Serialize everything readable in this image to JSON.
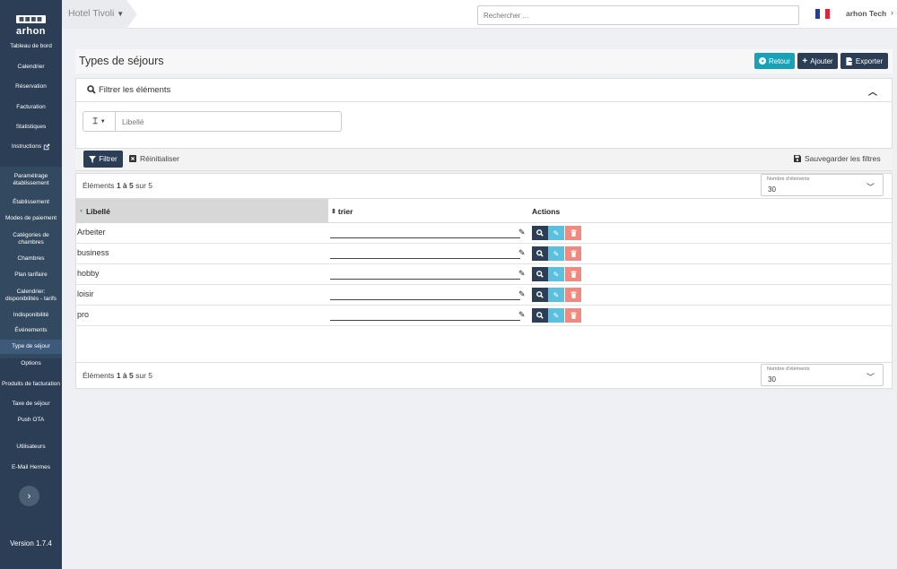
{
  "sidebar": {
    "logo_top": "arhon",
    "logo_name": "arhon",
    "items": [
      {
        "label": "Tableau de bord"
      },
      {
        "label": "Calendrier"
      },
      {
        "label": "Réservation"
      },
      {
        "label": "Facturation"
      },
      {
        "label": "Statistiques"
      },
      {
        "label": "Instructions"
      }
    ],
    "group_title": "Paramétrage établissement",
    "group_items": [
      {
        "label": "Établissement"
      },
      {
        "label": "Modes de paiement"
      },
      {
        "label": "Catégories de chambres"
      },
      {
        "label": "Chambres"
      },
      {
        "label": "Plan tarifaire"
      },
      {
        "label": "Calendrier: disponibilités - tarifs"
      },
      {
        "label": "Indisponibilité"
      },
      {
        "label": "Événements"
      },
      {
        "label": "Type de séjour"
      },
      {
        "label": "Options"
      },
      {
        "label": "Produits de facturation"
      },
      {
        "label": "Taxe de séjour"
      },
      {
        "label": "Push OTA"
      }
    ],
    "bottom_items": [
      {
        "label": "Utilisateurs"
      },
      {
        "label": "E-Mail Hermes"
      }
    ],
    "version": "Version 1.7.4"
  },
  "topbar": {
    "hotel": "Hotel Tivoli",
    "search_placeholder": "Rechercher ...",
    "user": "arhon Tech"
  },
  "page": {
    "title": "Types de séjours",
    "btn_back": "Retour",
    "btn_add": "Ajouter",
    "btn_export": "Exporter"
  },
  "filters": {
    "title": "Filtrer les éléments",
    "libelle_placeholder": "Libellé",
    "btn_filter": "Filtrer",
    "btn_reset": "Réinitialiser",
    "btn_save": "Sauvegarder les filtres"
  },
  "table": {
    "count_prefix": "Éléments",
    "count_range": "1 à 5",
    "count_suffix": "sur 5",
    "per_page_label": "Nombre d'éléments",
    "per_page_value": "30",
    "headers": {
      "libelle": "Libellé",
      "sort": "trier",
      "actions": "Actions"
    },
    "rows": [
      {
        "libelle": "Arbeiter"
      },
      {
        "libelle": "business"
      },
      {
        "libelle": "hobby"
      },
      {
        "libelle": "loisir"
      },
      {
        "libelle": "pro"
      }
    ]
  },
  "colors": {
    "sidebar": "#2b3e55",
    "teal": "#17a2b8",
    "view": "#2b3e55",
    "edit": "#5bc0de",
    "delete": "#f08a80"
  }
}
